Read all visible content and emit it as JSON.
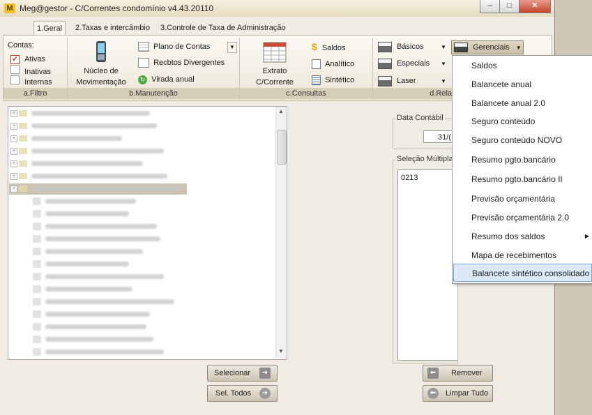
{
  "window": {
    "title": "Meg@gestor - C/Correntes condomínio v4.43.20110",
    "icon_letter": "M"
  },
  "tabs": [
    {
      "label": "1.Geral"
    },
    {
      "label": "2.Taxas e intercâmbio"
    },
    {
      "label": "3.Controle de Taxa de Administração"
    }
  ],
  "filtro": {
    "label": "Contas:",
    "options": [
      {
        "label": "Ativas",
        "checked": true
      },
      {
        "label": "Inativas",
        "checked": false
      },
      {
        "label": "Internas",
        "checked": false
      }
    ],
    "group_label": "a.Filtro"
  },
  "manutencao": {
    "nucleo_label_1": "Núcleo de",
    "nucleo_label_2": "Movimentação",
    "plano_label": "Plano de Contas",
    "recbtos_label": "Recbtos Divergentes",
    "virada_label": "Virada anual",
    "group_label": "b.Manutenção"
  },
  "consultas": {
    "extrato_label_1": "Extrato",
    "extrato_label_2": "C/Corrente",
    "saldos_label": "Saldos",
    "analitico_label": "Analítico",
    "sintetico_label": "Sintético",
    "group_label": "c.Consultas"
  },
  "relatorios": {
    "basicos_label": "Básicos",
    "especiais_label": "Especiais",
    "laser_label": "Laser",
    "gerenciais_label": "Gerenciais",
    "group_label": "d.Rela"
  },
  "data_contabil": {
    "legend": "Data Contábil",
    "value": "31/("
  },
  "selecao_multipla": {
    "legend": "Seleção Múltipla",
    "items": [
      "0213"
    ]
  },
  "buttons": {
    "selecionar": "Selecionar",
    "sel_todos": "Sel. Todos",
    "remover": "Remover",
    "limpar_tudo": "Limpar Tudo"
  },
  "gerenciais_menu": {
    "items": [
      {
        "label": "Saldos",
        "submenu": false
      },
      {
        "label": "Balancete anual",
        "submenu": false
      },
      {
        "label": "Balancete anual 2.0",
        "submenu": false
      },
      {
        "label": "Seguro conteúdo",
        "submenu": false
      },
      {
        "label": "Seguro conteúdo NOVO",
        "submenu": false
      },
      {
        "label": "Resumo pgto.bancário",
        "submenu": false
      },
      {
        "label": "Resumo pgto.bancário II",
        "submenu": false
      },
      {
        "label": "Previsão orçamentária",
        "submenu": false
      },
      {
        "label": "Previsão orçamentária 2.0",
        "submenu": false
      },
      {
        "label": "Resumo dos saldos",
        "submenu": true
      },
      {
        "label": "Mapa de recebimentos",
        "submenu": false
      },
      {
        "label": "Balancete sintético consolidado",
        "submenu": false,
        "selected": true
      }
    ]
  },
  "colors": {
    "accent": "#f3c226",
    "menu_highlight": "#dbe9f8",
    "ribbon_label_bg": "#d7ceb9"
  }
}
